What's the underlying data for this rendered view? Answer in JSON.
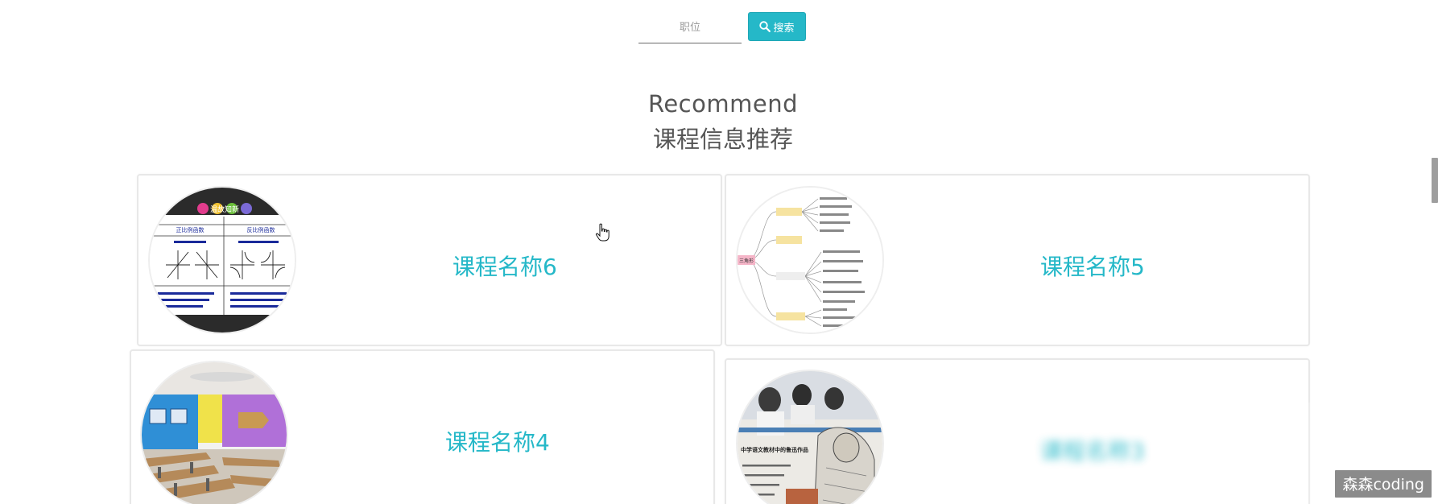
{
  "search": {
    "placeholder": "职位",
    "button_label": "搜索"
  },
  "section": {
    "title_en": "Recommend",
    "title_cn": "课程信息推荐"
  },
  "cards": [
    {
      "title": "课程名称6",
      "image": "math-functions-table-image"
    },
    {
      "title": "课程名称5",
      "image": "triangle-mindmap-image"
    },
    {
      "title": "课程名称4",
      "image": "classroom-photo-image"
    },
    {
      "title": "课程名称3",
      "image": "students-reading-illustration-image"
    }
  ],
  "thumb_text": {
    "card1_banner": "温故知新",
    "card1_col1": "正比例函数",
    "card1_col2": "反比例函数",
    "card2_node": "三角形",
    "card4_caption": "中学语文教材中的鲁迅作品"
  },
  "watermark": "森森coding",
  "colors": {
    "accent": "#25b8c8",
    "heading": "#555555",
    "card_border": "#e8e8e8"
  }
}
